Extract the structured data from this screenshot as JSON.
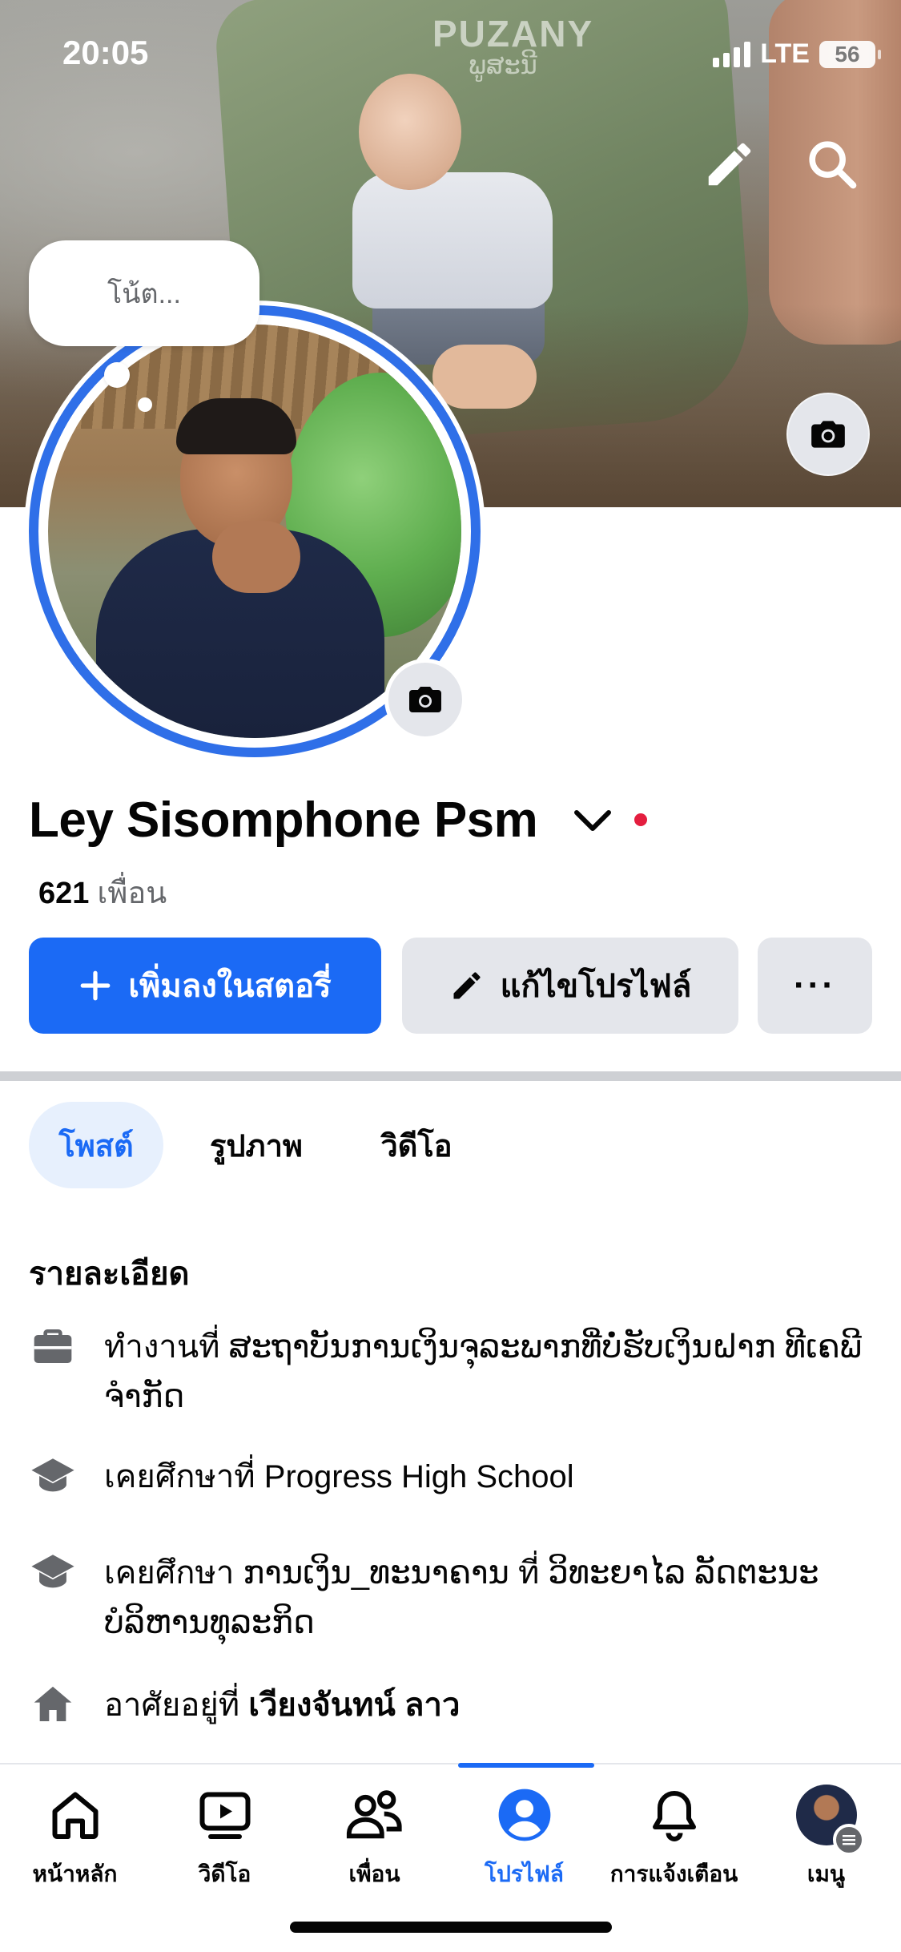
{
  "status_bar": {
    "time": "20:05",
    "network": "LTE",
    "battery": "56"
  },
  "cover": {
    "chair_text": "PUZANY",
    "chair_subtext": "ພູສະນີ"
  },
  "note": {
    "placeholder": "โน้ต..."
  },
  "profile": {
    "name": "Ley Sisomphone Psm",
    "friends_count": "621",
    "friends_label": "เพื่อน"
  },
  "actions": {
    "add_story": "เพิ่มลงในสตอรี่",
    "edit_profile": "แก้ไขโปรไฟล์",
    "more": "···"
  },
  "tabs": [
    {
      "label": "โพสต์",
      "active": true
    },
    {
      "label": "รูปภาพ",
      "active": false
    },
    {
      "label": "วิดีโอ",
      "active": false
    }
  ],
  "details": {
    "title": "รายละเอียด",
    "items": [
      {
        "icon": "briefcase-icon",
        "prefix": "ทำงานที่",
        "value": "ສະຖາບັນການເງິນຈຸລະພາກທີ່ບໍ່ຮັບເງິນຝາກ ທີເຄພີ ຈຳກັດ",
        "bold": false
      },
      {
        "icon": "graduation-cap-icon",
        "prefix": "เคยศึกษาที่",
        "value": "Progress High School",
        "bold": false
      },
      {
        "icon": "graduation-cap-icon",
        "prefix": "เคยศึกษา",
        "value": "ການເງິນ_ທະນາຄານ ที่ ວິທະຍາໄລ ລັດຕະນະບໍລິຫານທຸລະກິດ",
        "bold": false
      },
      {
        "icon": "home-icon",
        "prefix": "อาศัยอยู่ที่",
        "value": "เวียงจันทน์ ลาว",
        "bold": true
      }
    ]
  },
  "bottom_nav": [
    {
      "label": "หน้าหลัก",
      "icon": "home-icon",
      "active": false
    },
    {
      "label": "วิดีโอ",
      "icon": "video-icon",
      "active": false
    },
    {
      "label": "เพื่อน",
      "icon": "friends-icon",
      "active": false
    },
    {
      "label": "โปรไฟล์",
      "icon": "profile-icon",
      "active": true
    },
    {
      "label": "การแจ้งเตือน",
      "icon": "bell-icon",
      "active": false
    },
    {
      "label": "เมนู",
      "icon": "menu-avatar",
      "active": false
    }
  ],
  "colors": {
    "primary": "#1b6af5",
    "avatar_ring": "#2f6fe8",
    "online_dot": "#e41e3f",
    "secondary_button": "#e4e6eb",
    "muted_text": "#65676b"
  }
}
